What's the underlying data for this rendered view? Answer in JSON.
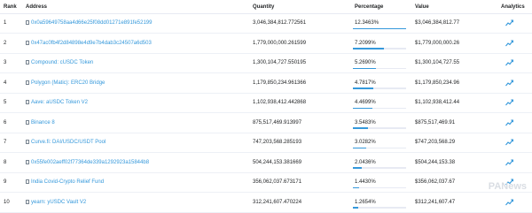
{
  "headers": {
    "rank": "Rank",
    "address": "Address",
    "quantity": "Quantity",
    "percentage": "Percentage",
    "value": "Value",
    "analytics": "Analytics"
  },
  "rows": [
    {
      "rank": "1",
      "address": "0x0a59649758aa4d66e25f08dd01271e891fe52199",
      "quantity": "3,046,384,812.772561",
      "percentage": "12.3463%",
      "pct_fraction": 0.123463,
      "value": "$3,046,384,812.77"
    },
    {
      "rank": "2",
      "address": "0x47ac0fb4f2d84898e4d9e7b4dab3c24507a6d503",
      "quantity": "1,779,000,000.261599",
      "percentage": "7.2099%",
      "pct_fraction": 0.072099,
      "value": "$1,779,000,000.26"
    },
    {
      "rank": "3",
      "address": "Compound: cUSDC Token",
      "quantity": "1,300,104,727.550195",
      "percentage": "5.2690%",
      "pct_fraction": 0.05269,
      "value": "$1,300,104,727.55"
    },
    {
      "rank": "4",
      "address": "Polygon (Matic): ERC20 Bridge",
      "quantity": "1,179,850,234.961366",
      "percentage": "4.7817%",
      "pct_fraction": 0.047817,
      "value": "$1,179,850,234.96"
    },
    {
      "rank": "5",
      "address": "Aave: aUSDC Token V2",
      "quantity": "1,102,938,412.442868",
      "percentage": "4.4699%",
      "pct_fraction": 0.044699,
      "value": "$1,102,938,412.44"
    },
    {
      "rank": "6",
      "address": "Binance 8",
      "quantity": "875,517,469.913997",
      "percentage": "3.5483%",
      "pct_fraction": 0.035483,
      "value": "$875,517,469.91"
    },
    {
      "rank": "7",
      "address": "Curve.fi: DAI/USDC/USDT Pool",
      "quantity": "747,203,568.285193",
      "percentage": "3.0282%",
      "pct_fraction": 0.030282,
      "value": "$747,203,568.29"
    },
    {
      "rank": "8",
      "address": "0x55fe002aeff02f77364de339a1292923a15844b8",
      "quantity": "504,244,153.381669",
      "percentage": "2.0436%",
      "pct_fraction": 0.020436,
      "value": "$504,244,153.38"
    },
    {
      "rank": "9",
      "address": "India Covid-Crypto Relief Fund",
      "quantity": "356,062,037.673171",
      "percentage": "1.4430%",
      "pct_fraction": 0.01443,
      "value": "$356,062,037.67"
    },
    {
      "rank": "10",
      "address": "yearn: yUSDC Vault V2",
      "quantity": "312,241,607.470224",
      "percentage": "1.2654%",
      "pct_fraction": 0.012654,
      "value": "$312,241,607.47"
    }
  ],
  "watermark": "PANews",
  "colors": {
    "link": "#3498db",
    "bar": "#3498db",
    "text": "#1e2022",
    "border": "#e7eaf3"
  },
  "icons": {
    "address_type": "document-icon",
    "analytics": "line-chart-icon"
  }
}
